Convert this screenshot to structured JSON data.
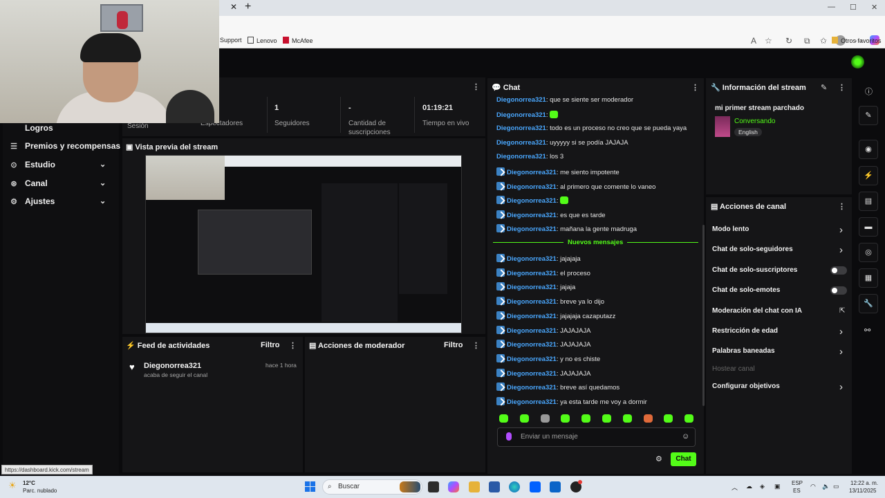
{
  "browser": {
    "close_tab": "✕",
    "new_tab": "+",
    "win_min": "—",
    "win_max": "☐",
    "win_close": "✕",
    "bookmarks": [
      "Support",
      "Lenovo",
      "McAfee"
    ],
    "other_favorites": "Otros favoritos",
    "status_url": "https://dashboard.kick.com/stream"
  },
  "sidebar": {
    "items": [
      {
        "label": "Logros",
        "icon": "trophy-icon",
        "chevron": false
      },
      {
        "label": "Premios y recompensas",
        "icon": "gift-icon",
        "chevron": false
      },
      {
        "label": "Estudio",
        "icon": "studio-icon",
        "chevron": true
      },
      {
        "label": "Canal",
        "icon": "channel-icon",
        "chevron": true
      },
      {
        "label": "Ajustes",
        "icon": "gear-icon",
        "chevron": true
      }
    ]
  },
  "stats": {
    "session_label": "Sesión",
    "viewers_label": "Espectadores",
    "followers_value": "1",
    "followers_label": "Seguidores",
    "subs_value": "-",
    "subs_label": "Cantidad de suscripciones",
    "live_value": "01:19:21",
    "live_label": "Tiempo en vivo"
  },
  "preview": {
    "title": "Vista previa del stream"
  },
  "activity": {
    "title": "Feed de actividades",
    "filter": "Filtro",
    "item_user": "Diegonorrea321",
    "item_time": "hace 1 hora",
    "item_text": "acaba de seguir el canal"
  },
  "mod_actions": {
    "title": "Acciones de moderador",
    "filter": "Filtro"
  },
  "chat": {
    "title": "Chat",
    "user": "Diegonorrea321",
    "messages_old": [
      {
        "badge": false,
        "text": ": que se siente ser moderador"
      },
      {
        "badge": false,
        "text": ": ",
        "emote": true
      },
      {
        "badge": false,
        "text": ": todo es un proceso no creo que se pueda yaya"
      },
      {
        "badge": false,
        "text": ": uyyyyy si se podía JAJAJA"
      },
      {
        "badge": false,
        "text": ": los 3"
      },
      {
        "badge": true,
        "text": ": me siento impotente"
      },
      {
        "badge": true,
        "text": ": al primero que comente lo vaneo"
      },
      {
        "badge": true,
        "text": ": ",
        "emote": true
      },
      {
        "badge": true,
        "text": ": es que es tarde"
      },
      {
        "badge": true,
        "text": ": mañana la gente madruga"
      }
    ],
    "new_messages_label": "Nuevos mensajes",
    "messages_new": [
      ": jajajaja",
      ": el proceso",
      ": jajaja",
      ": breve ya lo dijo",
      ": jajajaja cazaputazz",
      ": JAJAJAJA",
      ": JAJAJAJA",
      ": y no es chiste",
      ": JAJAJAJA",
      ": breve así quedamos",
      ": ya esta tarde me voy a dormir"
    ],
    "input_placeholder": "Enviar un mensaje",
    "send_label": "Chat"
  },
  "stream_info": {
    "title": "Información del stream",
    "stream_title": "mi primer stream parchado",
    "category": "Conversando",
    "language": "English"
  },
  "channel_actions": {
    "title": "Acciones de canal",
    "items": [
      {
        "label": "Modo lento",
        "control": "chevron"
      },
      {
        "label": "Chat de solo-seguidores",
        "control": "chevron"
      },
      {
        "label": "Chat de solo-suscriptores",
        "control": "toggle"
      },
      {
        "label": "Chat de solo-emotes",
        "control": "toggle"
      },
      {
        "label": "Moderación del chat con IA",
        "control": "external"
      },
      {
        "label": "Restricción de edad",
        "control": "chevron"
      },
      {
        "label": "Palabras baneadas",
        "control": "chevron"
      },
      {
        "label": "Hostear canal",
        "control": "none",
        "disabled": true
      },
      {
        "label": "Configurar objetivos",
        "control": "chevron"
      }
    ]
  },
  "taskbar": {
    "weather_temp": "12°C",
    "weather_desc": "Parc. nublado",
    "search": "Buscar",
    "lang_top": "ESP",
    "lang_bottom": "ES",
    "time": "12:22 a. m.",
    "date": "13/11/2025"
  },
  "colors": {
    "accent": "#53fc18",
    "username": "#4aa8ff",
    "bg": "#0b0b0d",
    "panel": "#151517"
  }
}
